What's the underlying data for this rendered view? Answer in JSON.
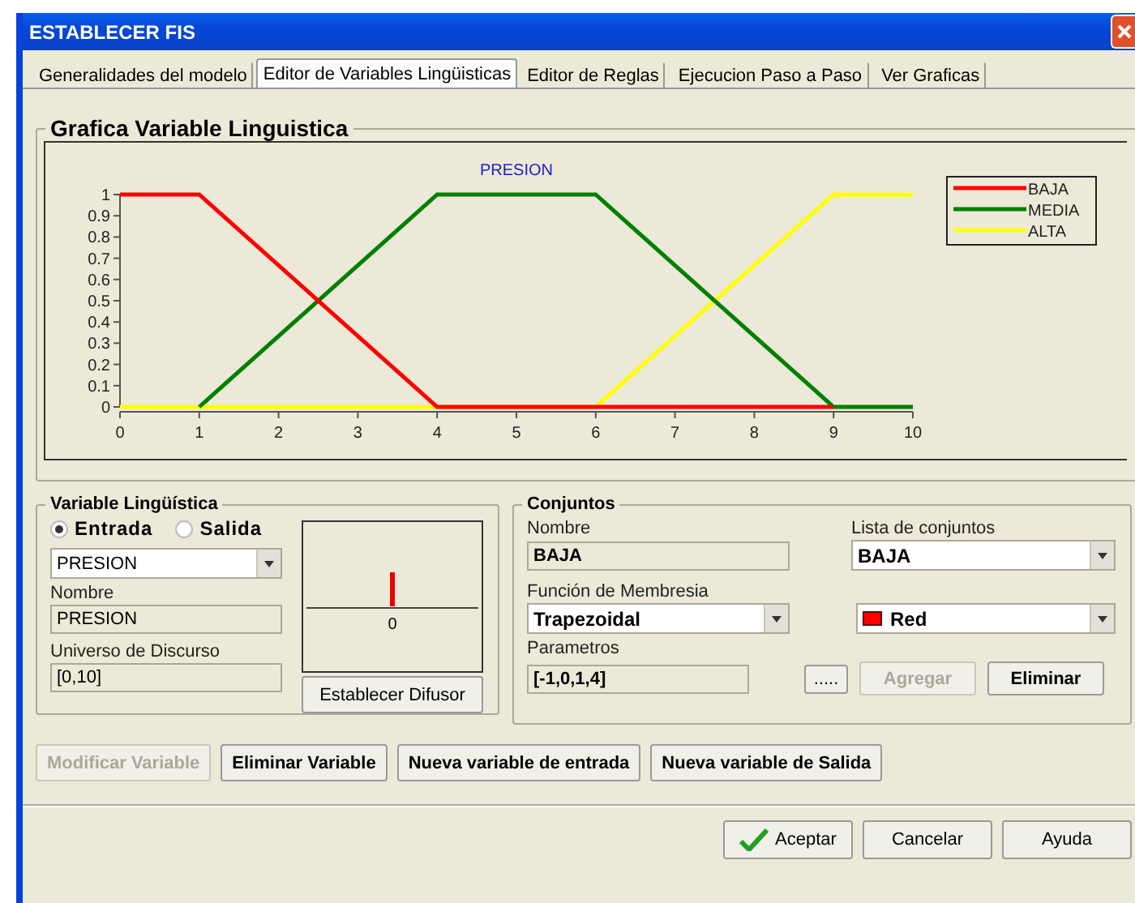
{
  "window": {
    "title": "ESTABLECER FIS"
  },
  "tabs": [
    {
      "label": "Generalidades del modelo",
      "selected": false
    },
    {
      "label": "Editor de Variables Lingüisticas",
      "selected": true
    },
    {
      "label": "Editor de Reglas",
      "selected": false
    },
    {
      "label": "Ejecucion Paso a Paso",
      "selected": false
    },
    {
      "label": "Ver Graficas",
      "selected": false
    }
  ],
  "graph_group": {
    "title": "Grafica Variable Linguistica",
    "chart_data": {
      "type": "line",
      "title": "PRESION",
      "legend": true,
      "x": [
        0,
        1,
        4,
        6,
        9,
        10
      ],
      "xlim": [
        0,
        10
      ],
      "ylim": [
        0,
        1
      ],
      "xticks": [
        0,
        1,
        2,
        3,
        4,
        5,
        6,
        7,
        8,
        9,
        10
      ],
      "yticks": [
        0,
        0.1,
        0.2,
        0.3,
        0.4,
        0.5,
        0.6,
        0.7,
        0.8,
        0.9,
        1
      ],
      "series": [
        {
          "name": "BAJA",
          "color": "#ff0000",
          "values": [
            1,
            1,
            0,
            0,
            0,
            null
          ]
        },
        {
          "name": "MEDIA",
          "color": "#008000",
          "values": [
            null,
            0,
            1,
            1,
            0,
            0
          ]
        },
        {
          "name": "ALTA",
          "color": "#ffff00",
          "values": [
            0,
            0,
            0,
            0,
            1,
            1
          ]
        }
      ]
    }
  },
  "variable": {
    "title": "Variable Lingüística",
    "io_options": [
      {
        "label": "Entrada",
        "selected": true
      },
      {
        "label": "Salida",
        "selected": false
      }
    ],
    "variable_select": "PRESION",
    "name_label": "Nombre",
    "name_value": "PRESION",
    "universe_label": "Universo de Discurso",
    "universe_value": "[0,10]",
    "diffuser_tick": "0",
    "diffuser_button": "Establecer Difusor"
  },
  "sets": {
    "title": "Conjuntos",
    "name_label": "Nombre",
    "name_value": "BAJA",
    "list_label": "Lista de conjuntos",
    "list_value": "BAJA",
    "function_label": "Función de Membresia",
    "function_value": "Trapezoidal",
    "color_value": "Red",
    "color": "#ff0000",
    "params_label": "Parametros",
    "params_value": "[-1,0,1,4]",
    "dots_button": ".....",
    "buttons": [
      {
        "label": "Agregar",
        "disabled": true
      },
      {
        "label": "Eliminar",
        "disabled": false
      }
    ]
  },
  "variable_buttons": [
    {
      "label": "Modificar Variable",
      "disabled": true
    },
    {
      "label": "Eliminar Variable",
      "disabled": false
    },
    {
      "label": "Nueva variable de entrada",
      "disabled": false
    },
    {
      "label": "Nueva variable de Salida",
      "disabled": false
    }
  ],
  "dialog_buttons": [
    {
      "kind": "ok",
      "label": "Aceptar"
    },
    {
      "kind": "plain",
      "label": "Cancelar"
    },
    {
      "kind": "plain",
      "label": "Ayuda"
    }
  ]
}
